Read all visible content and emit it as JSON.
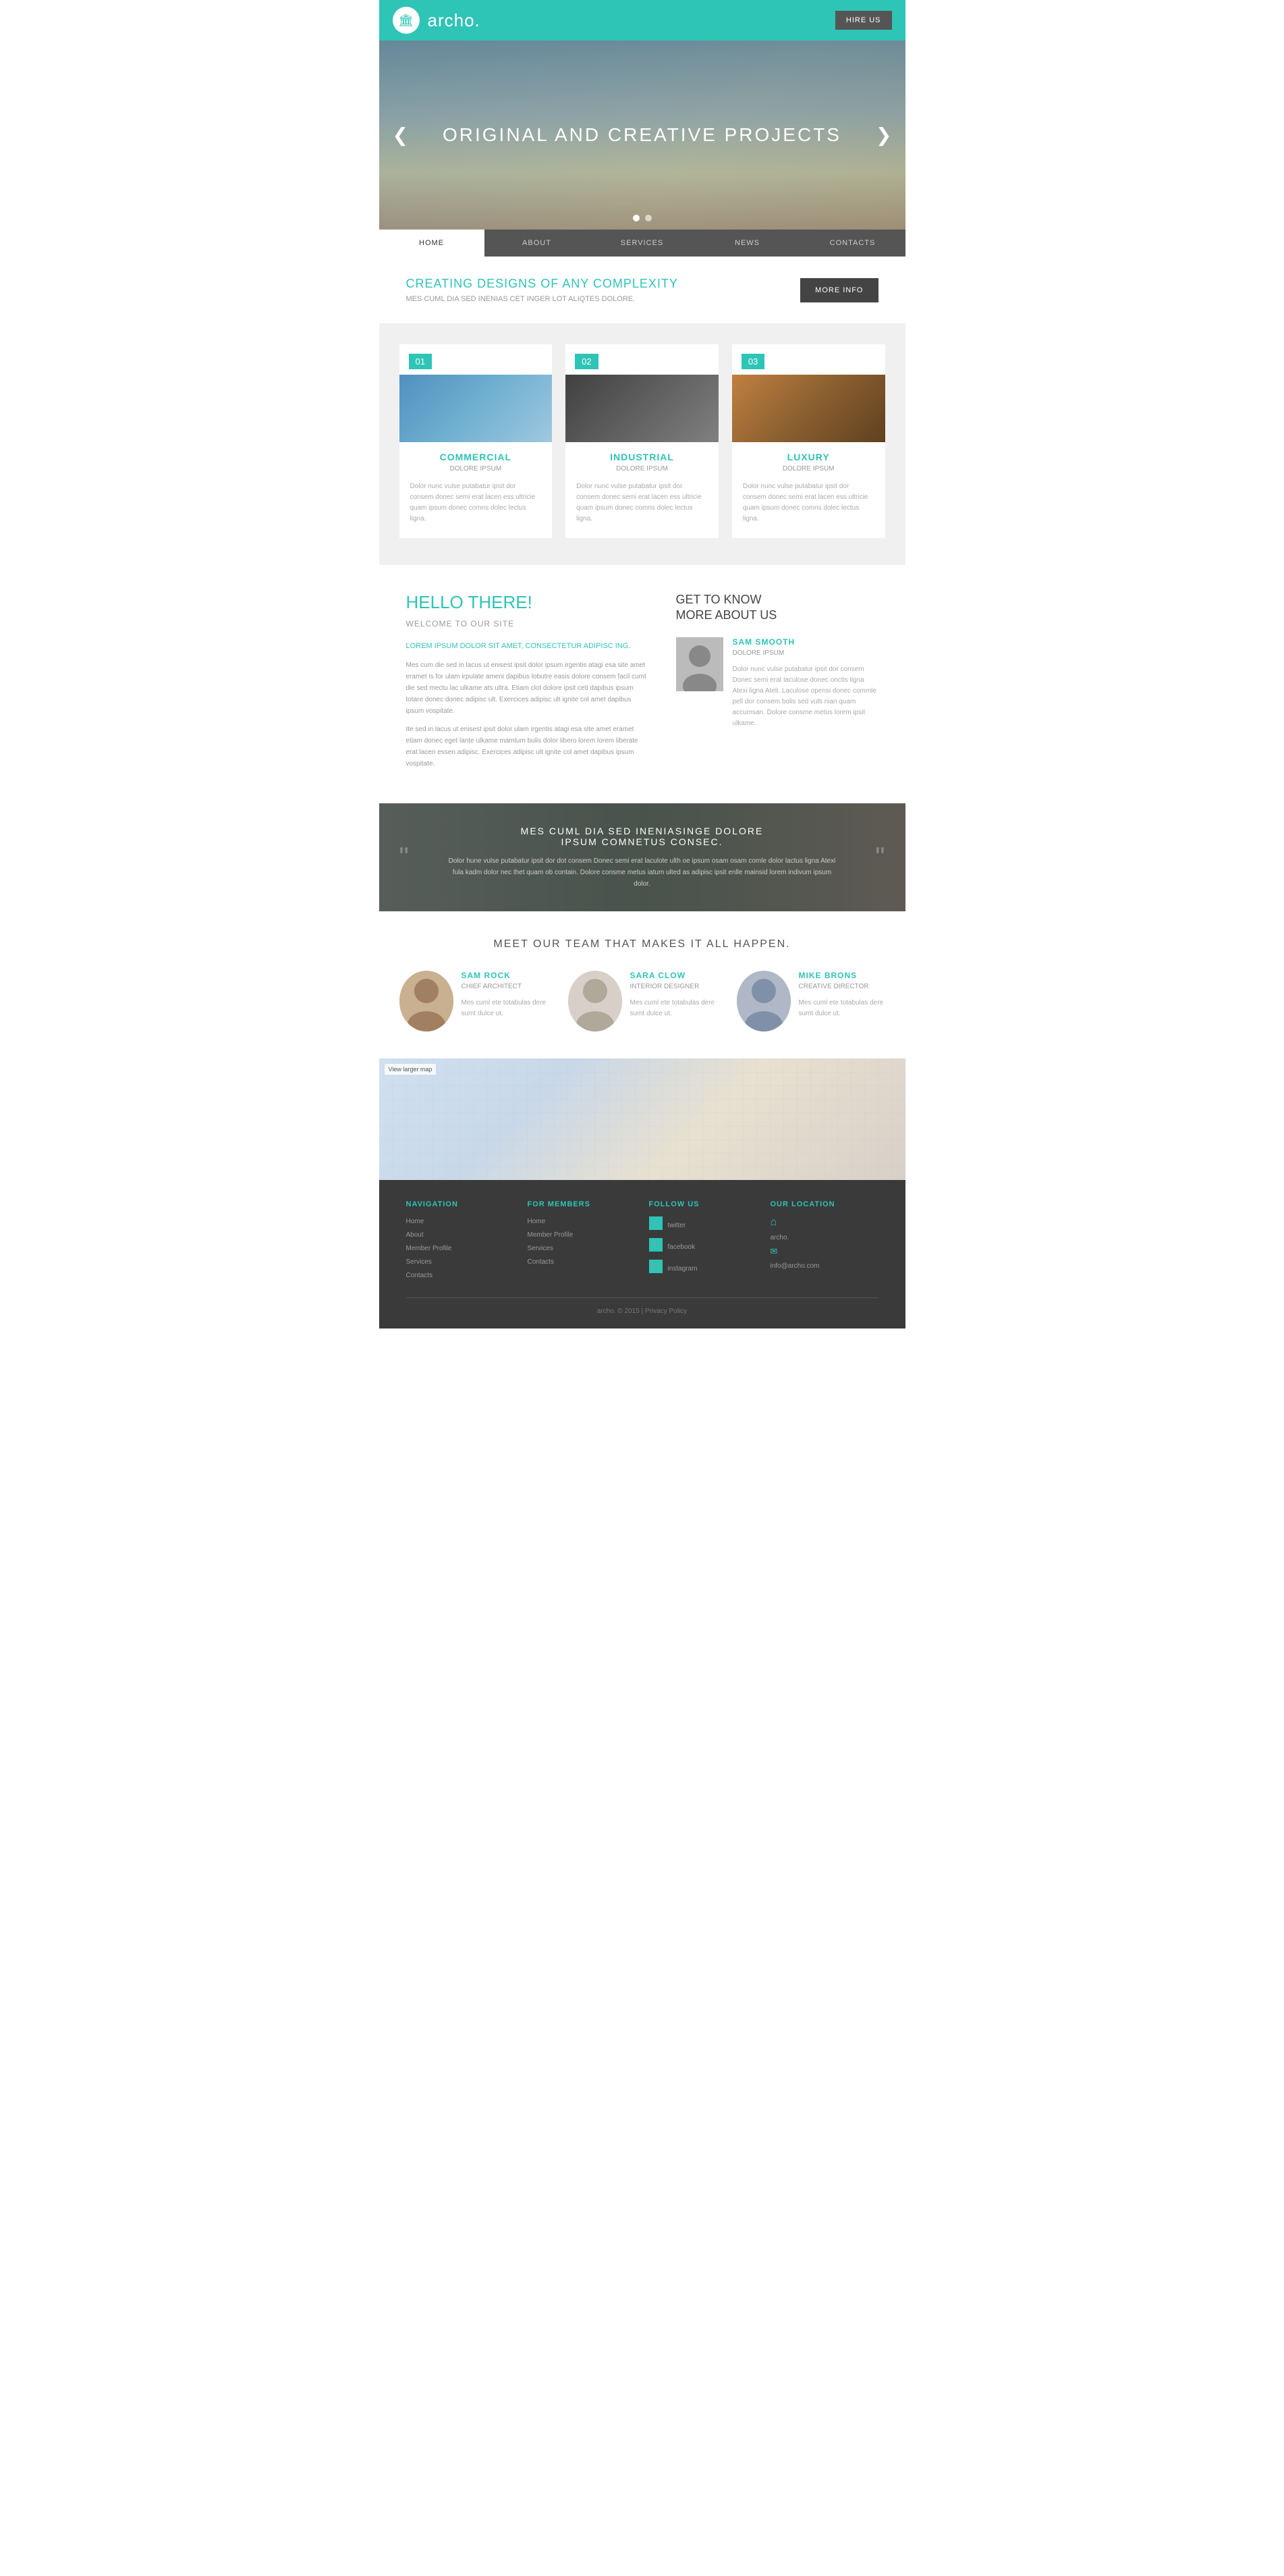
{
  "header": {
    "brand": "archo.",
    "hire_btn": "HIRE US",
    "logo_symbol": "🏛"
  },
  "hero": {
    "title": "ORIGINAL AND CREATIVE PROJECTS",
    "arrow_left": "❮",
    "arrow_right": "❯",
    "dots": [
      true,
      false
    ]
  },
  "nav": {
    "items": [
      {
        "label": "HOME",
        "active": true
      },
      {
        "label": "ABOUT",
        "active": false
      },
      {
        "label": "SERVICES",
        "active": false
      },
      {
        "label": "NEWS",
        "active": false
      },
      {
        "label": "CONTACTS",
        "active": false
      }
    ]
  },
  "intro": {
    "heading": "CREATING DESIGNS OF ANY COMPLEXITY",
    "subtext": "MES CUML DIA SED INENIAS CET INGER LOT ALIQTES DOLORE.",
    "more_info_btn": "MORE INFO"
  },
  "services": {
    "items": [
      {
        "num": "01",
        "title": "COMMERCIAL",
        "sub": "DOLORE IPSUM",
        "text": "Dolor nunc vulse putabatur ipsit dor consem donec semi erat lacen ess ultricie quam ipsum donec comns dolec lectus ligna."
      },
      {
        "num": "02",
        "title": "INDUSTRIAL",
        "sub": "DOLORE IPSUM",
        "text": "Dolor nunc vulse putabatur ipsit dor consem donec semi erat lacen ess ultricie quam ipsum donec comns dolec lectus ligna."
      },
      {
        "num": "03",
        "title": "LUXURY",
        "sub": "DOLORE IPSUM",
        "text": "Dolor nunc vulse putabatur ipsit dor consem donec semi erat lacen ess ultricie quam ipsum donec comns dolec lectus ligna."
      }
    ]
  },
  "about": {
    "hello": "HELLO THERE!",
    "welcome": "WELCOME TO OUR SITE",
    "lorem_heading": "LOREM IPSUM DOLOR SIT AMET, CONSECTETUR ADIPISC ING.",
    "para1": "Mes cum die sed in lacus ut enisest ipsit dolor ipsum irgentis atagi esa site amet eramet is for ulam irpulate ameni dapibus lobutre easis dolore consem facil cumt die sed mectu lac ulkame ats ultra. Etiam clot dolore ipsit ceti dapibus ipsum totare donec donec adipisc ult. Exercices adipisc ult ignite col amet dapibus ipsum vospitate.",
    "para2": "Ite sed in lacus ut enisest ipsit dolor ulam irgentis atagi esa site amet eramet etiam donec eget lante ulkame mamlum bulis dolor libero lorem lorem liberate erat lacen essen adipisc. Exercices adipisc ult ignite col amet dapibus ipsum vospitate.",
    "get_to_know": "GET TO KNOW\nMORE ABOUT US",
    "person": {
      "name": "SAM SMOOTH",
      "role": "DOLORE IPSUM",
      "text": "Dolor nunc vulse putabatur ipsit dor consem Donec semi erat laculose donec onctis ligna Atexi ligna Ateli. Laculose opensi donec commle pell dor consem bolis sed vulti nian quam accumsan. Dolore consme metus lorem ipsit ulkame."
    }
  },
  "quote": {
    "title": "MES CUML DIA SED INENIASINGE DOLORE\nIPSUM COMNETUS CONSEC.",
    "text": "Dolor hune vulse putabatur ipsit dor dot consem Donec semi erat laculote ulth oe ipsum osam osam comle dolor lactus ligna Atexi\nfula kadm dolor nec thet quam ob contain. Dolore consme metus iatum ulted as adipisc ipsit enlle mainsid lorem\nindivum ipsum dolor.",
    "quote_left": "“",
    "quote_right": "”"
  },
  "team": {
    "title": "MEET OUR TEAM THAT MAKES IT ALL HAPPEN.",
    "members": [
      {
        "name": "SAM ROCK",
        "role": "CHIEF ARCHITECT",
        "text": "Mes cuml ete totabulas dere\nsumt dulce ut."
      },
      {
        "name": "SARA CLOW",
        "role": "INTERIOR DESIGNER",
        "text": "Mes cuml ete totabulas dere\nsumt dulce ut."
      },
      {
        "name": "MIKE BRONS",
        "role": "CREATIVE DIRECTOR",
        "text": "Mes cuml ete totabulas dere\nsumt dulce ut."
      }
    ]
  },
  "map": {
    "label": "View larger map"
  },
  "footer": {
    "navigation": {
      "heading": "NAVIGATION",
      "links": [
        "Home",
        "About",
        "Member Profile",
        "Services",
        "Contacts"
      ]
    },
    "for_members": {
      "heading": "FOR MEMBERS",
      "links": [
        "Home",
        "Member Profile",
        "Services",
        "Contacts"
      ]
    },
    "follow_us": {
      "heading": "FOLLOW US",
      "social": [
        {
          "icon": "t",
          "label": "twitter"
        },
        {
          "icon": "f",
          "label": "facebook"
        },
        {
          "icon": "in",
          "label": "instagram"
        }
      ]
    },
    "our_location": {
      "heading": "OUR LOCATION",
      "icon": "⌂",
      "address": "archo.",
      "phone_icon": "✉",
      "phone": "info@archo.com"
    },
    "bottom": "archo. © 2015 | Privacy Policy"
  }
}
